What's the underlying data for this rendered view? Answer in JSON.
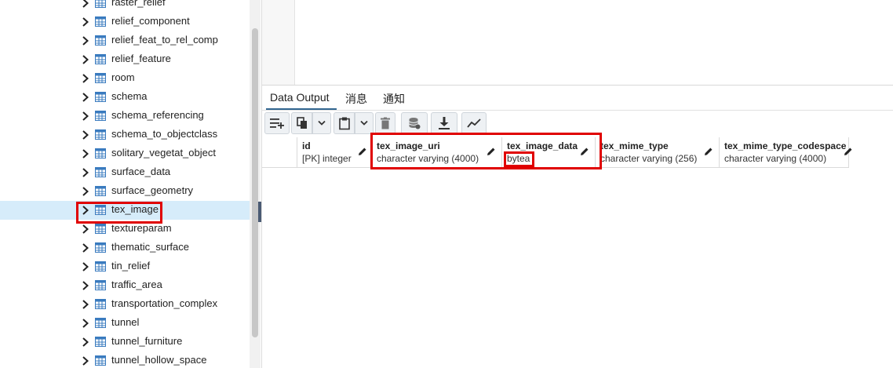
{
  "tree": {
    "items": [
      {
        "label": "raster_relief"
      },
      {
        "label": "relief_component"
      },
      {
        "label": "relief_feat_to_rel_comp"
      },
      {
        "label": "relief_feature"
      },
      {
        "label": "room"
      },
      {
        "label": "schema"
      },
      {
        "label": "schema_referencing"
      },
      {
        "label": "schema_to_objectclass"
      },
      {
        "label": "solitary_vegetat_object"
      },
      {
        "label": "surface_data"
      },
      {
        "label": "surface_geometry"
      },
      {
        "label": "tex_image",
        "selected": true
      },
      {
        "label": "textureparam"
      },
      {
        "label": "thematic_surface"
      },
      {
        "label": "tin_relief"
      },
      {
        "label": "traffic_area"
      },
      {
        "label": "transportation_complex"
      },
      {
        "label": "tunnel"
      },
      {
        "label": "tunnel_furniture"
      },
      {
        "label": "tunnel_hollow_space"
      }
    ]
  },
  "tabs": {
    "data_output": "Data Output",
    "messages": "消息",
    "notifications": "通知"
  },
  "toolbar": {
    "icons": [
      "add-row-icon",
      "copy-icon",
      "copy-dropdown-icon",
      "paste-icon",
      "paste-dropdown-icon",
      "delete-icon",
      "save-data-icon",
      "download-icon",
      "graph-icon"
    ]
  },
  "grid": {
    "columns": [
      {
        "name": "id",
        "type": "[PK] integer"
      },
      {
        "name": "tex_image_uri",
        "type": "character varying (4000)"
      },
      {
        "name": "tex_image_data",
        "type": "bytea"
      },
      {
        "name": "tex_mime_type",
        "type": "character varying (256)"
      },
      {
        "name": "tex_mime_type_codespace",
        "type": "character varying (4000)"
      }
    ]
  },
  "colors": {
    "selection": "#d6ecfa",
    "highlight_box": "#e00000",
    "tab_accent": "#326690",
    "table_icon": "#3a7bbf"
  }
}
